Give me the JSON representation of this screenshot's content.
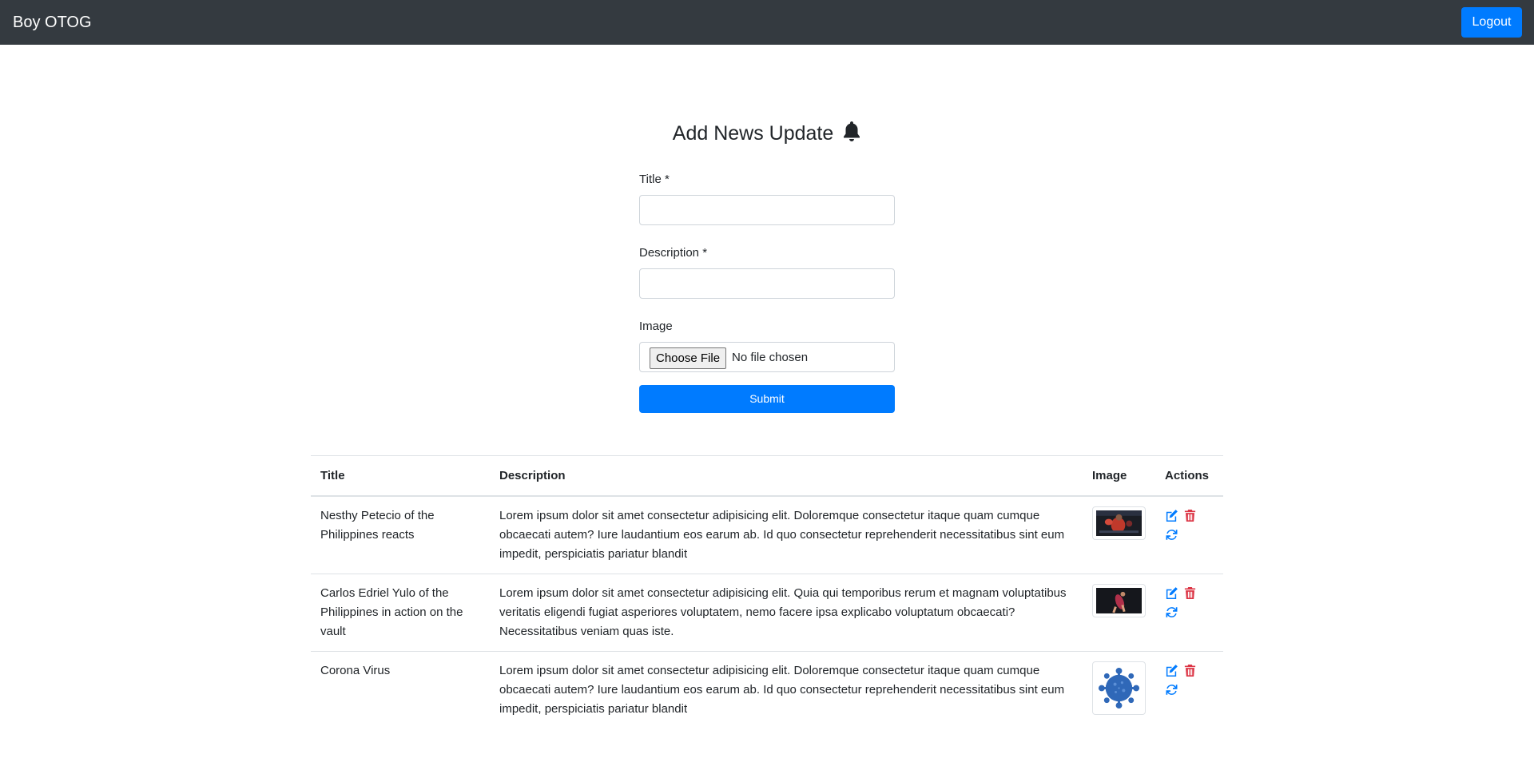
{
  "navbar": {
    "brand": "Boy OTOG",
    "logout_label": "Logout"
  },
  "form": {
    "heading": "Add News Update",
    "heading_icon": "bell-icon",
    "title_label": "Title *",
    "title_value": "",
    "description_label": "Description *",
    "description_value": "",
    "image_label": "Image",
    "choose_file_label": "Choose File",
    "file_status": "No file chosen",
    "submit_label": "Submit"
  },
  "table": {
    "headers": {
      "title": "Title",
      "description": "Description",
      "image": "Image",
      "actions": "Actions"
    },
    "rows": [
      {
        "title": "Nesthy Petecio of the Philippines reacts",
        "description": "Lorem ipsum dolor sit amet consectetur adipisicing elit. Doloremque consectetur itaque quam cumque obcaecati autem? Iure laudantium eos earum ab. Id quo consectetur reprehenderit necessitatibus sint eum impedit, perspiciatis pariatur blandit",
        "image": "boxer-photo"
      },
      {
        "title": "Carlos Edriel Yulo of the Philippines in action on the vault",
        "description": "Lorem ipsum dolor sit amet consectetur adipisicing elit. Quia qui temporibus rerum et magnam voluptatibus veritatis eligendi fugiat asperiores voluptatem, nemo facere ipsa explicabo voluptatum obcaecati? Necessitatibus veniam quas iste.",
        "image": "gymnast-photo"
      },
      {
        "title": "Corona Virus",
        "description": "Lorem ipsum dolor sit amet consectetur adipisicing elit. Doloremque consectetur itaque quam cumque obcaecati autem? Iure laudantium eos earum ab. Id quo consectetur reprehenderit necessitatibus sint eum impedit, perspiciatis pariatur blandit",
        "image": "virus-illustration"
      }
    ],
    "action_icons": [
      "edit-icon",
      "trash-icon",
      "refresh-icon"
    ]
  },
  "colors": {
    "navbar": "#343a40",
    "primary": "#007bff",
    "danger": "#dc3545",
    "text": "#212529",
    "border": "#dee2e6"
  }
}
